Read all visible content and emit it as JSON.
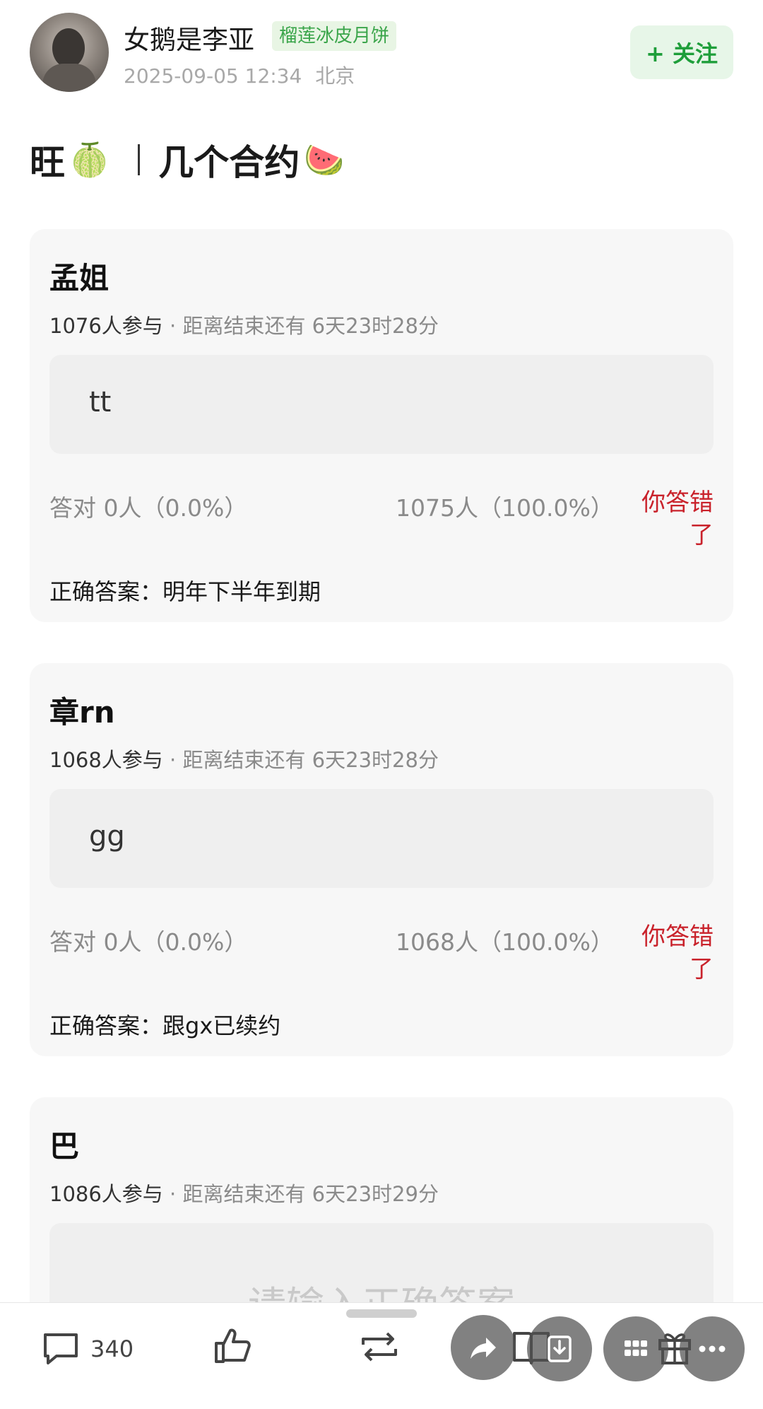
{
  "post": {
    "username": "女鹅是李亚",
    "badge": "榴莲冰皮月饼",
    "datetime": "2025-09-05 12:34",
    "location": "北京",
    "follow_label": "+ 关注",
    "title_left": "旺",
    "title_emoji_left": "🍈",
    "title_right": "几个合约",
    "title_emoji_right": "🍉"
  },
  "quizzes": [
    {
      "name": "孟姐",
      "participants": "1076人参与",
      "countdown": "· 距离结束还有 6天23时28分",
      "my_answer": "tt",
      "correct_stat": "答对 0人（0.0%）",
      "wrong_stat": "1075人（100.0%）",
      "result": "你答错了",
      "correct_answer": "正确答案：明年下半年到期"
    },
    {
      "name": "章rn",
      "participants": "1068人参与",
      "countdown": "· 距离结束还有 6天23时28分",
      "my_answer": "gg",
      "correct_stat": "答对 0人（0.0%）",
      "wrong_stat": "1068人（100.0%）",
      "result": "你答错了",
      "correct_answer": "正确答案：跟gx已续约"
    },
    {
      "name": "巴",
      "participants": "1086人参与",
      "countdown": "· 距离结束还有 6天23时29分",
      "input_placeholder": "请输入正确答案"
    }
  ],
  "bottom_bar": {
    "comment_count": "340",
    "icons": [
      "comment-icon",
      "like-icon",
      "repost-icon",
      "share-icon",
      "download-icon",
      "grid-icon",
      "more-icon"
    ]
  }
}
